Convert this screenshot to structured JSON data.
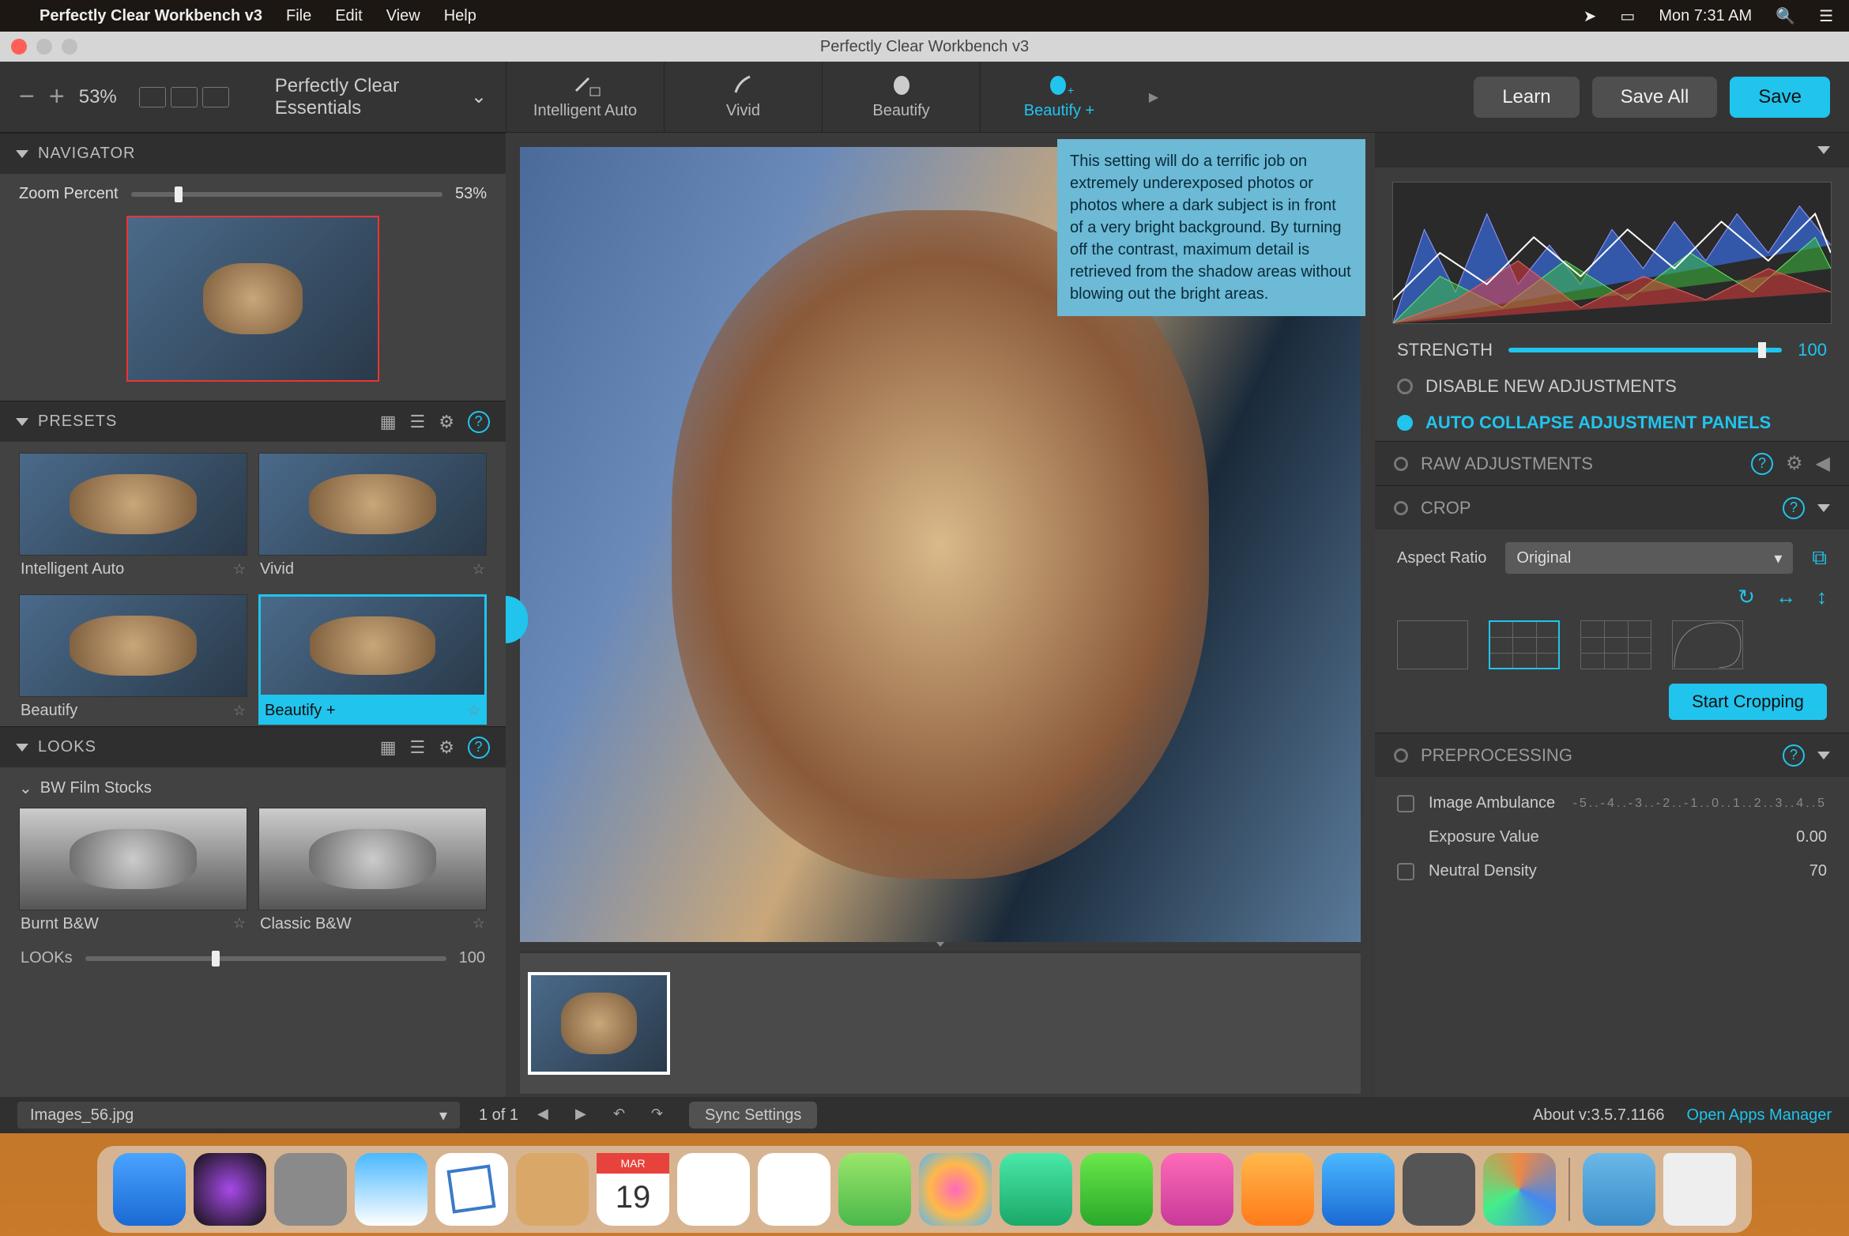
{
  "mac_menu": {
    "apple": "",
    "app_name": "Perfectly Clear Workbench v3",
    "items": [
      "File",
      "Edit",
      "View",
      "Help"
    ],
    "clock": "Mon 7:31 AM"
  },
  "window": {
    "title": "Perfectly Clear Workbench v3"
  },
  "toolbar": {
    "zoom_value": "53%",
    "essentials_label": "Perfectly Clear Essentials",
    "modes": [
      "Intelligent Auto",
      "Vivid",
      "Beautify",
      "Beautify +"
    ],
    "active_mode_index": 3,
    "learn": "Learn",
    "save_all": "Save All",
    "save": "Save"
  },
  "navigator": {
    "title": "NAVIGATOR",
    "zoom_label": "Zoom Percent",
    "zoom_value": "53%",
    "slider_pct": 14
  },
  "presets": {
    "title": "PRESETS",
    "items": [
      {
        "label": "Intelligent Auto"
      },
      {
        "label": "Vivid"
      },
      {
        "label": "Beautify"
      },
      {
        "label": "Beautify +",
        "selected": true
      }
    ]
  },
  "looks": {
    "title": "LOOKS",
    "category": "BW Film Stocks",
    "items": [
      {
        "label": "Burnt B&W"
      },
      {
        "label": "Classic B&W"
      }
    ],
    "slider_label": "LOOKs",
    "slider_value": "100"
  },
  "tooltip_text": "This setting will do a terrific job on extremely underexposed photos or photos where a dark subject is in front of a very bright background. By turning off the contrast, maximum detail is retrieved from the shadow areas without blowing out the bright areas.",
  "right": {
    "strength_label": "STRENGTH",
    "strength_value": "100",
    "toggle_disable": "DISABLE NEW ADJUSTMENTS",
    "toggle_autocollapse": "AUTO COLLAPSE ADJUSTMENT PANELS",
    "sections": {
      "raw": "RAW ADJUSTMENTS",
      "crop": "CROP",
      "preprocessing": "PREPROCESSING"
    },
    "crop": {
      "aspect_label": "Aspect Ratio",
      "aspect_value": "Original",
      "start_btn": "Start Cropping"
    },
    "preprocessing": {
      "ambulance": "Image Ambulance",
      "ev_label": "Exposure Value",
      "ev_value": "0.00",
      "ruler": "-5..-4..-3..-2..-1..0..1..2..3..4..5",
      "nd_label": "Neutral Density",
      "nd_value": "70"
    }
  },
  "status": {
    "filename": "Images_56.jpg",
    "counter": "1 of 1",
    "sync": "Sync Settings",
    "about": "About v:3.5.7.1166",
    "manager": "Open Apps Manager"
  },
  "dock_apps": [
    "finder",
    "siri",
    "launchpad",
    "safari",
    "mail",
    "contacts",
    "calendar",
    "reminders",
    "notes",
    "maps",
    "photos",
    "messages",
    "facetime",
    "itunes",
    "ibooks",
    "appstore",
    "settings",
    "custom"
  ],
  "dock_right": [
    "downloads",
    "trash"
  ]
}
